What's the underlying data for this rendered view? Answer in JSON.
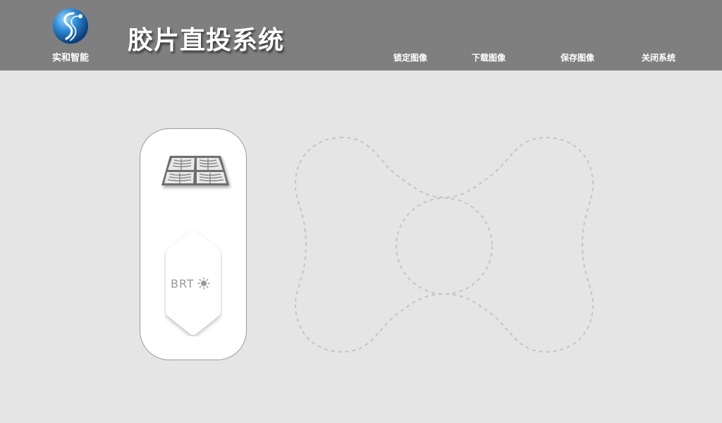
{
  "header": {
    "logo_text": "实和智能",
    "title": "胶片直投系统",
    "menu": [
      {
        "label": "锁定图像"
      },
      {
        "label": "下载图像"
      },
      {
        "label": "保存图像"
      },
      {
        "label": "关闭系统"
      }
    ]
  },
  "panel": {
    "layout_icon": "xray-grid-icon",
    "brightness": {
      "label": "BRT",
      "icon": "sun-icon"
    }
  },
  "joystick": {
    "icon": "directional-pad-outline"
  },
  "colors": {
    "header_bg": "#7f7f7f",
    "page_bg": "#e5e5e5",
    "panel_bg": "#ffffff",
    "header_text": "#ffffff",
    "accent_logo": "#2a7fc4"
  }
}
